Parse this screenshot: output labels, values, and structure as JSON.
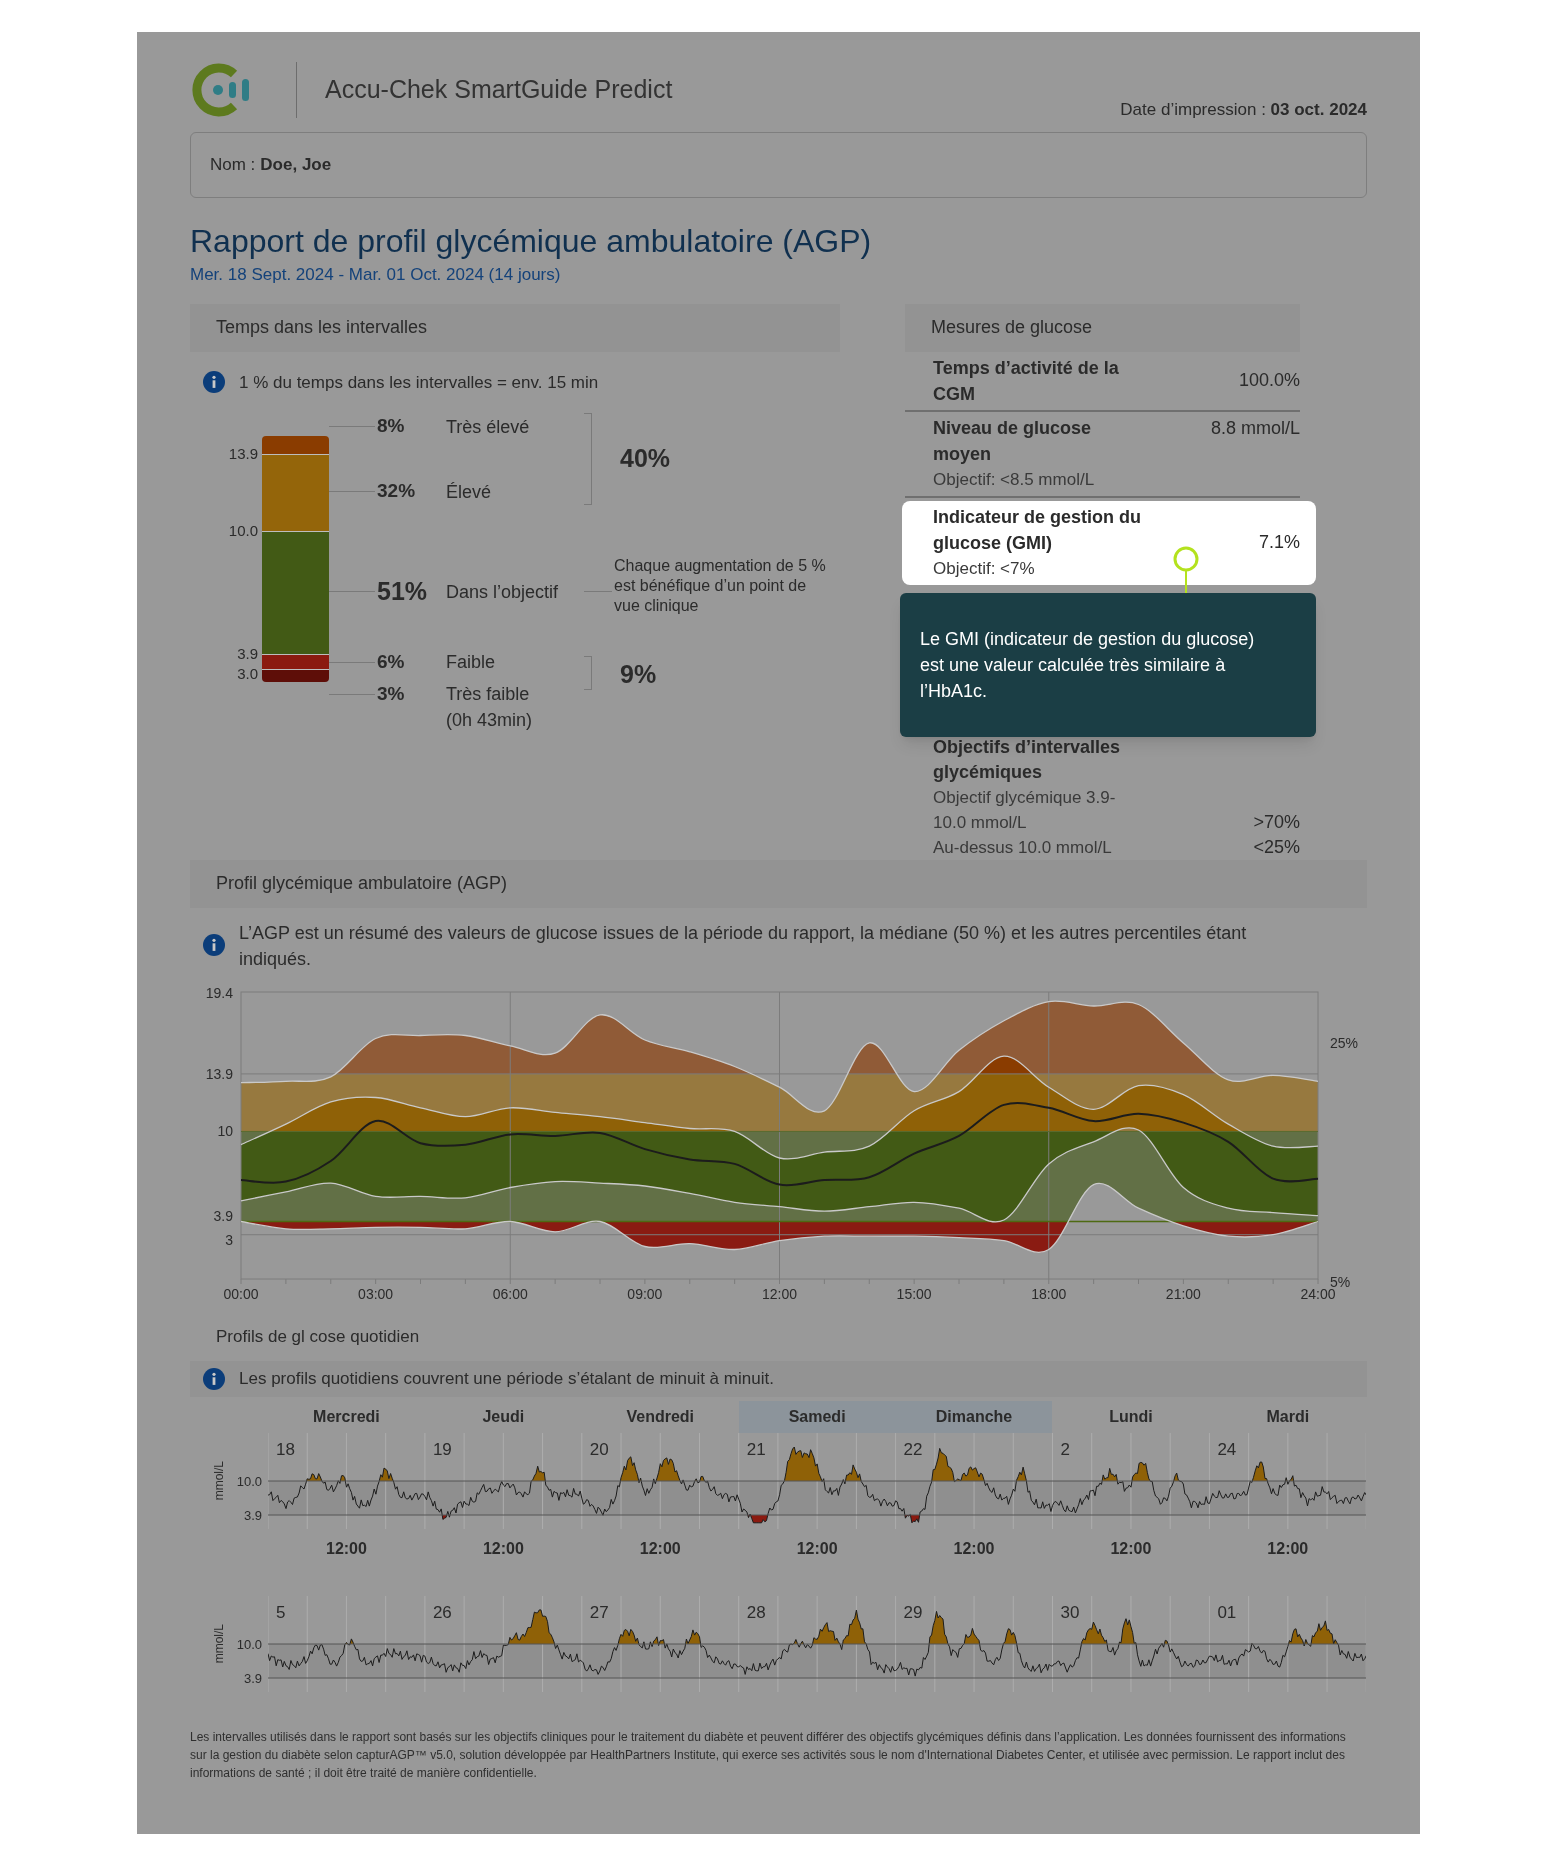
{
  "header": {
    "app_name": "Accu-Chek SmartGuide Predict",
    "print_date_label": "Date d’impression :",
    "print_date": "03 oct. 2024"
  },
  "patient": {
    "label": "Nom :",
    "name": "Doe, Joe"
  },
  "report": {
    "title": "Rapport de profil glycémique ambulatoire (AGP)",
    "period": "Mer. 18 Sept. 2024 - Mar. 01 Oct. 2024 (14 jours)"
  },
  "time_in_ranges": {
    "title": "Temps dans les intervalles",
    "info": "1 % du temps dans les intervalles = env. 15 min",
    "thresholds": [
      "13.9",
      "10.0",
      "3.9",
      "3.0"
    ],
    "ranges": [
      {
        "percent": "8%",
        "label": "Très élevé",
        "color": "#8a3c00"
      },
      {
        "percent": "32%",
        "label": "Élevé",
        "color": "#94650a"
      },
      {
        "percent": "51%",
        "label": "Dans l’objectif",
        "color": "#425a15"
      },
      {
        "percent": "6%",
        "label": "Faible",
        "color": "#8b1a10"
      },
      {
        "percent": "3%",
        "label": "Très faible",
        "note": "(0h 43min)",
        "color": "#5e0e08"
      }
    ],
    "groups": [
      {
        "total": "40%"
      },
      {
        "total": "9%"
      }
    ],
    "target_note": "Chaque augmentation de 5 % est bénéfique d’un point de vue clinique"
  },
  "glucose_measures": {
    "title": "Mesures de glucose",
    "rows": [
      {
        "label": "Temps d’activité de la CGM",
        "value": "100.0%",
        "highlighted": false
      },
      {
        "label": "Niveau de glucose moyen",
        "value": "8.8 mmol/L",
        "target": "Objectif: <8.5 mmol/L",
        "highlighted": false
      },
      {
        "label": "Indicateur de gestion du glucose (GMI)",
        "value": "7.1%",
        "target": "Objectif: <7%",
        "highlighted": true
      }
    ],
    "tooltip": "Le GMI (indicateur de gestion du glucose) est une valeur calculée très similaire à l’HbA1c.",
    "targets": {
      "title": "Objectifs d’intervalles glycémiques",
      "rows": [
        {
          "label": "Objectif glycémique 3.9-10.0 mmol/L",
          "value": ">70%"
        },
        {
          "label": "Au-dessus 10.0 mmol/L",
          "value": "<25%"
        }
      ]
    }
  },
  "agp": {
    "title": "Profil glycémique ambulatoire (AGP)",
    "info": "L’AGP est un résumé des valeurs de glucose issues de la période du rapport, la médiane (50 %) et les autres percentiles étant indiqués.",
    "chart_data": {
      "type": "line",
      "grid": true,
      "ref_lines": [
        {
          "axis": "y",
          "value": 10
        },
        {
          "axis": "y",
          "value": 3.9
        }
      ],
      "x": [
        0,
        1,
        2,
        3,
        4,
        5,
        6,
        7,
        8,
        9,
        10,
        11,
        12,
        13,
        14,
        15,
        16,
        17,
        18,
        19,
        20,
        21,
        22,
        23,
        24
      ],
      "xlim": [
        0,
        24
      ],
      "ylim": [
        0,
        19.45
      ],
      "xticks": [
        {
          "value": 0,
          "label": "00:00"
        },
        {
          "value": 3,
          "label": "03:00"
        },
        {
          "value": 6,
          "label": "06:00"
        },
        {
          "value": 9,
          "label": "09:00"
        },
        {
          "value": 12,
          "label": "12:00"
        },
        {
          "value": 15,
          "label": "15:00"
        },
        {
          "value": 18,
          "label": "18:00"
        },
        {
          "value": 21,
          "label": "21:00"
        },
        {
          "value": 24,
          "label": "24:00"
        }
      ],
      "yticks": [
        19.4,
        13.9,
        10,
        3.9,
        3
      ],
      "series": [
        {
          "values": [
            13.3,
            13.4,
            13.7,
            16.3,
            16.5,
            16.5,
            15.8,
            15.3,
            17.9,
            16.2,
            15.4,
            14.4,
            13,
            11.4,
            16,
            12.7,
            15.5,
            17.5,
            18.8,
            18.5,
            18.6,
            16,
            13.5,
            13.8,
            13.4
          ]
        },
        {
          "values": [
            9.1,
            10.5,
            12,
            12.3,
            11.6,
            11,
            11.6,
            11.3,
            11,
            10.6,
            10.2,
            10,
            8.2,
            8.6,
            9,
            11.4,
            12.7,
            15.1,
            13,
            11.5,
            13.1,
            12.5,
            10.5,
            9,
            9
          ]
        },
        {
          "values": [
            6.7,
            6.6,
            8,
            10.7,
            9.2,
            9.1,
            9.8,
            9.7,
            9.9,
            8.8,
            8.1,
            7.8,
            6.4,
            6.7,
            6.9,
            8.5,
            9.7,
            11.8,
            11.6,
            10.7,
            11.2,
            10.6,
            9.3,
            6.8,
            6.8
          ]
        },
        {
          "name": "25%",
          "values": [
            5.3,
            5.9,
            6.5,
            5.6,
            5.6,
            5.5,
            6.2,
            6.6,
            6.5,
            6.3,
            5.8,
            5.2,
            4.9,
            4.6,
            4.9,
            5.2,
            4.8,
            4.0,
            7.8,
            9.3,
            10.1,
            6.2,
            4.8,
            4.5,
            4.3
          ]
        },
        {
          "name": "5%",
          "values": [
            3.9,
            3.4,
            3.4,
            3.5,
            3.5,
            3.4,
            3.9,
            3.2,
            3.9,
            2.2,
            2.4,
            2.0,
            2.6,
            2.9,
            2.9,
            2.9,
            2.8,
            2.6,
            2.0,
            6.4,
            4.8,
            3.6,
            2.9,
            3.0,
            3.9
          ]
        }
      ]
    }
  },
  "daily_profiles": {
    "title": "Profils de gl  cose quotidien",
    "info": "Les profils quotidiens couvrent une période s’étalant de minuit à minuit.",
    "days": [
      {
        "name": "Mercredi",
        "weekend": false
      },
      {
        "name": "Jeudi",
        "weekend": false
      },
      {
        "name": "Vendredi",
        "weekend": false
      },
      {
        "name": "Samedi",
        "weekend": true
      },
      {
        "name": "Dimanche",
        "weekend": true
      },
      {
        "name": "Lundi",
        "weekend": false
      },
      {
        "name": "Mardi",
        "weekend": false
      }
    ],
    "weeks": [
      {
        "unit": "mmol/L",
        "y_ticks": [
          "10.0",
          "3.9"
        ],
        "dates": [
          "18",
          "19",
          "20",
          "21",
          "22",
          "2",
          "24"
        ],
        "time_ticks": [
          "12:00",
          "12:00",
          "12:00",
          "12:00",
          "12:00",
          "12:00",
          "12:00"
        ]
      },
      {
        "unit": "mmol/L",
        "y_ticks": [
          "10.0",
          "3.9"
        ],
        "dates": [
          "5",
          "26",
          "27",
          "28",
          "29",
          "30",
          "01"
        ]
      }
    ]
  },
  "footer": "Les intervalles utilisés dans le rapport sont basés sur les objectifs cliniques pour le traitement du diabète et peuvent différer des objectifs glycémiques définis dans l’application. Les données fournissent des informations sur la gestion du diabète selon capturAGP™ v5.0, solution développée par HealthPartners Institute, qui exerce ses activités sous le nom d'International Diabetes Center, et utilisée avec permission. Le rapport inclut des informations de santé ; il doit être traité de manière confidentielle."
}
